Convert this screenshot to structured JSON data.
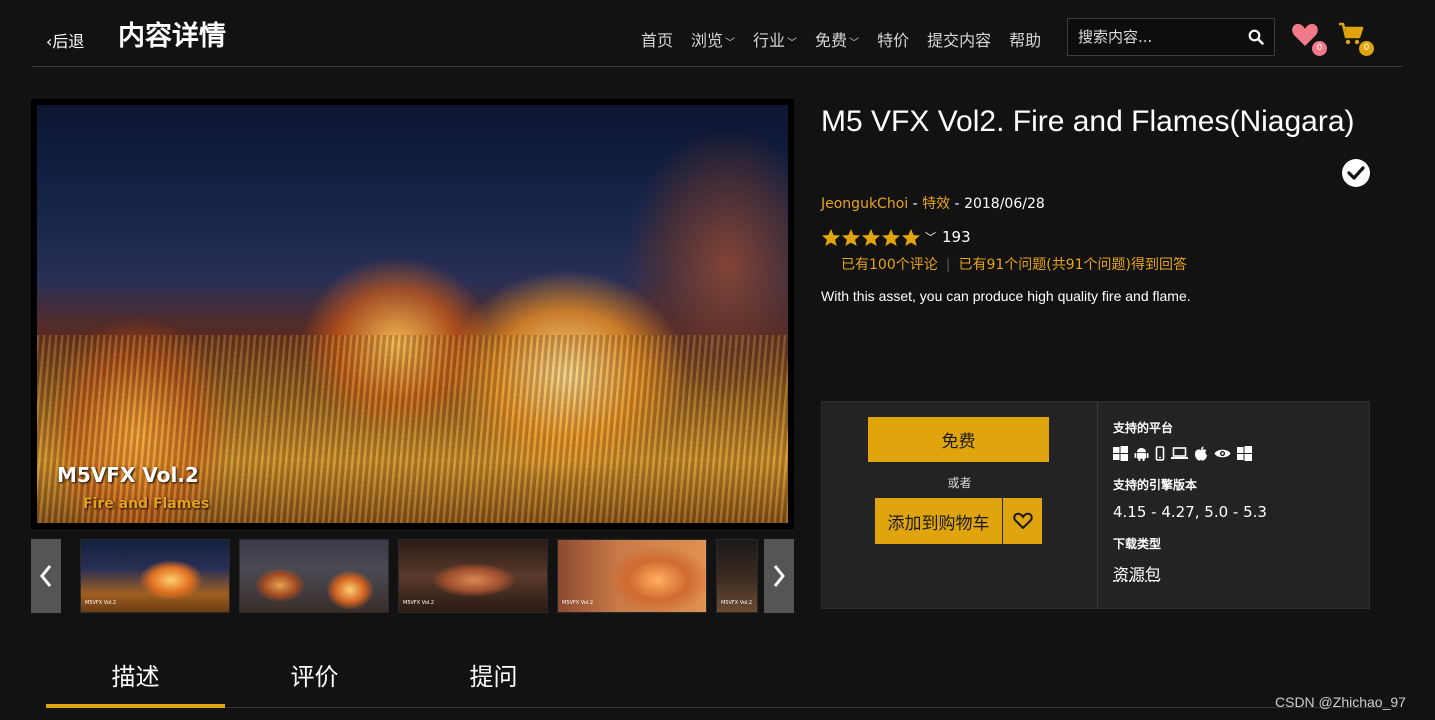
{
  "header": {
    "back_label": "‹后退",
    "title": "内容详情",
    "nav": [
      {
        "label": "首页",
        "dropdown": false
      },
      {
        "label": "浏览",
        "dropdown": true
      },
      {
        "label": "行业",
        "dropdown": true
      },
      {
        "label": "免费",
        "dropdown": true
      },
      {
        "label": "特价",
        "dropdown": false
      },
      {
        "label": "提交内容",
        "dropdown": false
      },
      {
        "label": "帮助",
        "dropdown": false
      }
    ],
    "search_placeholder": "搜索内容...",
    "wishlist_count": "0",
    "cart_count": "0",
    "wishlist_color": "#f07a8a",
    "cart_color": "#e0a40d"
  },
  "gallery": {
    "image_title": "M5VFX Vol.2",
    "image_subtitle": "Fire and Flames",
    "thumbnails": [
      "thumb-1",
      "thumb-2",
      "thumb-3",
      "thumb-4",
      "thumb-5"
    ]
  },
  "product": {
    "title": "M5 VFX Vol2. Fire and Flames(Niagara)",
    "author": "JeongukChoi",
    "sep1": " - ",
    "category": "特效",
    "sep2": " - ",
    "date": "2018/06/28",
    "rating_stars": 5,
    "rating_count": "193",
    "reviews_text": "已有100个评论",
    "questions_text": "已有91个问题(共91个问题)得到回答",
    "description": "With this asset, you can produce high quality fire and flame."
  },
  "purchase": {
    "free_label": "免费",
    "or_label": "或者",
    "add_to_cart_label": "添加到购物车",
    "platforms_label": "支持的平台",
    "platform_icons": [
      "windows-icon",
      "android-icon",
      "phone-icon",
      "laptop-icon",
      "apple-icon",
      "vr-eye-icon",
      "windows-icon"
    ],
    "engine_label": "支持的引擎版本",
    "engine_versions": "4.15 - 4.27, 5.0 - 5.3",
    "download_label": "下载类型",
    "download_type": "资源包"
  },
  "tabs": [
    {
      "label": "描述",
      "active": true
    },
    {
      "label": "评价",
      "active": false
    },
    {
      "label": "提问",
      "active": false
    }
  ],
  "watermark": "CSDN @Zhichao_97",
  "colors": {
    "accent": "#e0a40d",
    "background": "#121212",
    "panel": "#232323"
  }
}
